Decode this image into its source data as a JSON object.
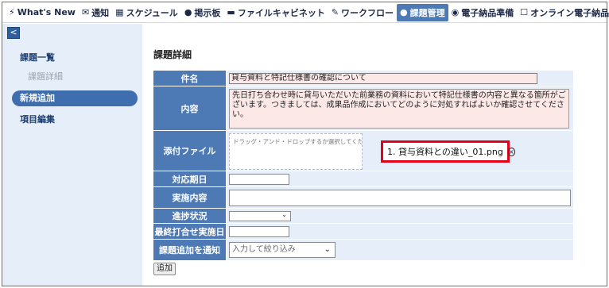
{
  "nav": {
    "items": [
      {
        "label": "What's New",
        "icon": "⚡",
        "icon_name": "lightning-icon"
      },
      {
        "label": "通知",
        "icon": "✉",
        "icon_name": "mail-icon"
      },
      {
        "label": "スケジュール",
        "icon": "▦",
        "icon_name": "calendar-icon"
      },
      {
        "label": "掲示板",
        "icon": "●",
        "icon_name": "chat-bubbles-icon"
      },
      {
        "label": "ファイルキャビネット",
        "icon": "▬",
        "icon_name": "cabinet-icon"
      },
      {
        "label": "ワークフロー",
        "icon": "✎",
        "icon_name": "edit-icon"
      },
      {
        "label": "課題管理",
        "icon": "●",
        "icon_name": "users-icon"
      },
      {
        "label": "電子納品準備",
        "icon": "◉",
        "icon_name": "radio-icon"
      },
      {
        "label": "オンライン電子納品",
        "icon": "☐",
        "icon_name": "checkbox-icon"
      }
    ],
    "active_index": 6,
    "help_glyph": "?"
  },
  "sidebar": {
    "collapse_glyph": "<",
    "issue_list": "課題一覧",
    "issue_detail": "課題詳細",
    "new_add": "新規追加",
    "item_edit": "項目編集"
  },
  "page": {
    "title": "課題詳細"
  },
  "form": {
    "subject_label": "件名",
    "subject_value": "貸与資料と特記仕様書の確認について",
    "content_label": "内容",
    "content_value": "先日打ち合わせ時に貸与いただいた前業務の資料において特記仕様書の内容と異なる箇所がございます。つきましては、成果品作成においてどのように対処すればよいか確認させてください。",
    "attach_label": "添付ファイル",
    "dropzone_text": "ドラッグ・アンド・ドロップするか選択してください",
    "attached_file": "1. 貸与資料との違い_01.png",
    "remove_glyph": "×",
    "due_label": "対応期日",
    "action_label": "実施内容",
    "progress_label": "進捗状況",
    "last_meeting_label": "最終打合せ実施日",
    "notify_label": "課題追加を通知",
    "notify_placeholder": "入力して絞り込み",
    "chevron": "⌄",
    "add_button": "追加"
  },
  "colors": {
    "accent": "#4d79b4",
    "sidebar_bg": "#e6eef9",
    "highlight_border": "#e3001b"
  }
}
